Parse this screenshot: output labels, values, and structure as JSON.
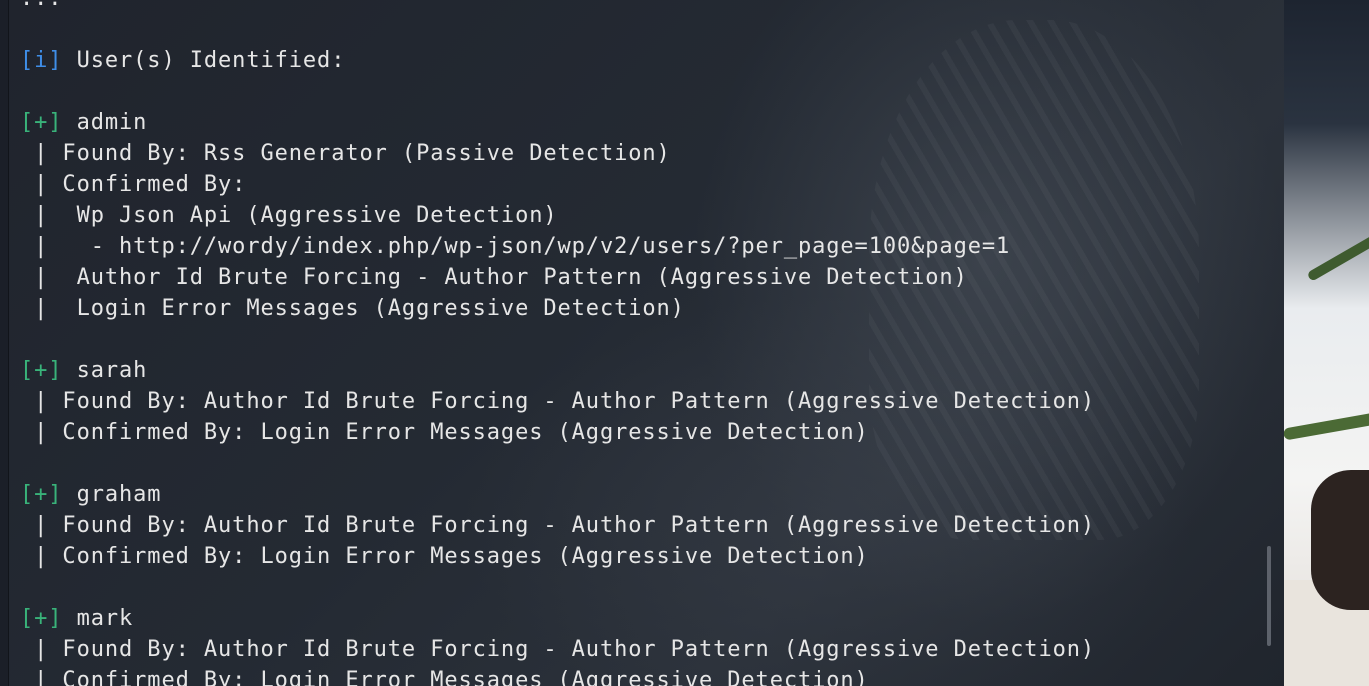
{
  "terminal": {
    "top_partial": "...",
    "users_header": {
      "tag": "[i]",
      "text": " User(s) Identified:"
    },
    "users": [
      {
        "tag": "[+]",
        "name": " admin",
        "lines": [
          " | Found By: Rss Generator (Passive Detection)",
          " | Confirmed By:",
          " |  Wp Json Api (Aggressive Detection)",
          " |   - http://wordy/index.php/wp-json/wp/v2/users/?per_page=100&page=1",
          " |  Author Id Brute Forcing - Author Pattern (Aggressive Detection)",
          " |  Login Error Messages (Aggressive Detection)"
        ]
      },
      {
        "tag": "[+]",
        "name": " sarah",
        "lines": [
          " | Found By: Author Id Brute Forcing - Author Pattern (Aggressive Detection)",
          " | Confirmed By: Login Error Messages (Aggressive Detection)"
        ]
      },
      {
        "tag": "[+]",
        "name": " graham",
        "lines": [
          " | Found By: Author Id Brute Forcing - Author Pattern (Aggressive Detection)",
          " | Confirmed By: Login Error Messages (Aggressive Detection)"
        ]
      },
      {
        "tag": "[+]",
        "name": " mark",
        "lines": [
          " | Found By: Author Id Brute Forcing - Author Pattern (Aggressive Detection)",
          " | Confirmed By: Login Error Messages (Aggressive Detection)"
        ]
      }
    ]
  },
  "colors": {
    "info_tag": "#3f8ee8",
    "success_tag": "#39b37a",
    "text": "#e6e6e6"
  }
}
